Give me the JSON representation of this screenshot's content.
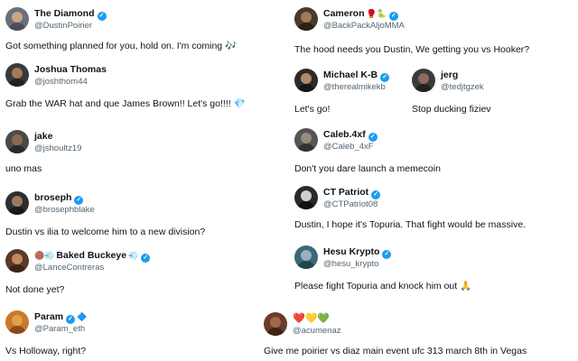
{
  "left_column": [
    {
      "name": "The Diamond",
      "verified": true,
      "handle": "@DustinPoirier",
      "text": "Got something planned for you, hold on. I'm coming 🎶",
      "avatar_color": "#6b6f78",
      "avatar_skin": "#c9a58a"
    },
    {
      "name": "Joshua Thomas",
      "verified": false,
      "handle": "@joshthom44",
      "text": "Grab the WAR hat and que James Brown!! Let's go!!!! 💎",
      "avatar_color": "#3a3a3a",
      "avatar_skin": "#a47a5a"
    },
    {
      "name": "jake",
      "verified": false,
      "handle": "@jshoultz19",
      "text": "uno mas",
      "avatar_color": "#4a4a4a",
      "avatar_skin": "#8a6a52"
    },
    {
      "name": "broseph",
      "verified": true,
      "handle": "@brosephblake",
      "text": "Dustin vs ilia to welcome him to a new division?",
      "avatar_color": "#2e2e2e",
      "avatar_skin": "#9a7a62"
    },
    {
      "name": "Baked Buckeye",
      "verified": true,
      "handle": "@LanceContreras",
      "text": "Not done yet?",
      "avatar_color": "#5a3a2a",
      "avatar_skin": "#c48a5a",
      "prefix_emoji": "🟤💨",
      "suffix_emoji": "💨"
    },
    {
      "name": "Param",
      "verified": true,
      "handle": "@Param_eth",
      "text": "Vs Holloway, right?",
      "avatar_color": "#c97a2a",
      "avatar_skin": "#e0a24a",
      "suffix_emoji": "🔷"
    }
  ],
  "right_column": [
    {
      "name": "Cameron",
      "verified": true,
      "handle": "@BackPackAljoMMA",
      "text": "The hood needs you Dustin, We getting you vs Hooker?",
      "avatar_color": "#4a3a2a",
      "avatar_skin": "#a07a5a",
      "suffix_emoji": "🥊🐍"
    },
    {
      "name": "Michael K-B",
      "verified": true,
      "handle": "@therealmikekb",
      "text": "Let's go!",
      "avatar_color": "#2a2a2a",
      "avatar_skin": "#b08a6a"
    },
    {
      "name": "jerg",
      "verified": false,
      "handle": "@tedjtgzek",
      "text": "Stop ducking fiziev",
      "avatar_color": "#3a3a3a",
      "avatar_skin": "#8a6a5a"
    },
    {
      "name": "Caleb.4xf",
      "verified": true,
      "handle": "@Caleb_4xF",
      "text": "Don't you dare launch a memecoin",
      "avatar_color": "#555555",
      "avatar_skin": "#9a8a7a"
    },
    {
      "name": "CT Patriot",
      "verified": true,
      "handle": "@CTPatriot08",
      "text": "Dustin, I hope it's Topuria.  That fight would be massive.",
      "avatar_color": "#2a2a2a",
      "avatar_skin": "#d0d0d0"
    },
    {
      "name": "Hesu Krypto",
      "verified": true,
      "handle": "@hesu_krypto",
      "text": "Please fight Topuria and knock him out 🙏",
      "avatar_color": "#3a6a7a",
      "avatar_skin": "#9ab0b8"
    },
    {
      "name": "",
      "hearts": "❤️💛💚",
      "verified": false,
      "handle": "@acumenaz",
      "text": "Give me poirier vs diaz main event ufc 313 march 8th in Vegas",
      "avatar_color": "#6a3a2a",
      "avatar_skin": "#a06a4a"
    }
  ],
  "colors": {
    "verified": "#1d9bf0",
    "handle": "#536471",
    "text": "#0f1419"
  }
}
